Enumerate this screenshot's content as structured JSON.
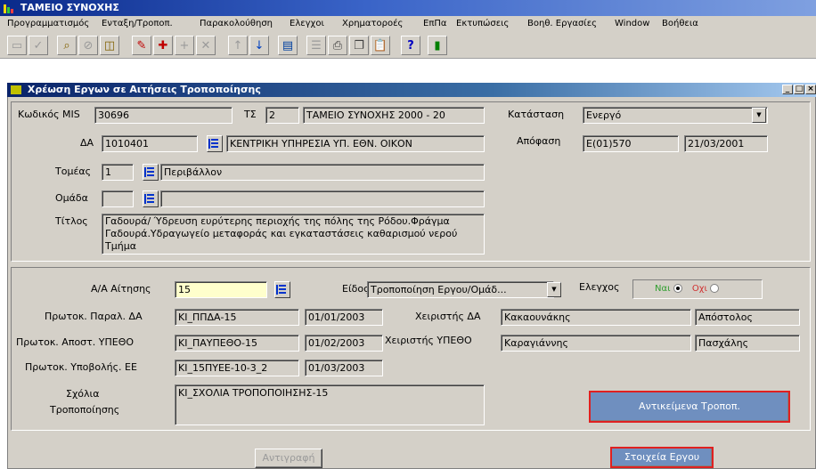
{
  "app": {
    "title": "ΤΑΜΕΙΟ ΣΥΝΟΧΗΣ"
  },
  "menu": {
    "items": [
      {
        "label": "Προγραμματισμός"
      },
      {
        "label": "Ενταξη/Τροποπ."
      },
      {
        "label": "Παρακολούθηση"
      },
      {
        "label": "Ελεγχοι"
      },
      {
        "label": "Χρηματοροές"
      },
      {
        "label": "ΕπΠα"
      },
      {
        "label": "Εκτυπώσεις"
      },
      {
        "label": "Βοηθ. Εργασίες"
      },
      {
        "label": "Window"
      },
      {
        "label": "Βοήθεια"
      }
    ]
  },
  "toolbar": {
    "buttons": [
      {
        "icon": "save-icon"
      },
      {
        "icon": "check-icon"
      },
      {
        "icon": "query-icon"
      },
      {
        "icon": "cancel-query-icon"
      },
      {
        "icon": "execute-query-icon"
      },
      {
        "icon": "edit-icon"
      },
      {
        "icon": "insert-record-icon"
      },
      {
        "icon": "add-icon"
      },
      {
        "icon": "delete-icon"
      },
      {
        "icon": "up-arrow-icon"
      },
      {
        "icon": "down-arrow-icon"
      },
      {
        "icon": "screen-icon"
      },
      {
        "icon": "list-icon"
      },
      {
        "icon": "print-icon"
      },
      {
        "icon": "copy-icon"
      },
      {
        "icon": "paste-icon"
      },
      {
        "icon": "help-icon"
      },
      {
        "icon": "exit-icon"
      }
    ]
  },
  "window": {
    "title": "Χρέωση Εργων σε Αιτήσεις Τροποποίησης"
  },
  "header": {
    "mis_label": "Κωδικός MIS",
    "mis_value": "30696",
    "ts_label": "ΤΣ",
    "ts_value": "2",
    "ts_name": "ΤΑΜΕΙΟ ΣΥΝΟΧΗΣ 2000 - 20",
    "status_label": "Κατάσταση",
    "status_value": "Ενεργό",
    "da_label": "ΔΑ",
    "da_value": "1010401",
    "da_name": "ΚΕΝΤΡΙΚΗ ΥΠΗΡΕΣΙΑ ΥΠ. ΕΘΝ. ΟΙΚΟΝ",
    "decision_label": "Απόφαση",
    "decision_value": "Ε(01)570",
    "decision_date": "21/03/2001",
    "sector_label": "Τομέας",
    "sector_value": "1",
    "sector_name": "Περιβάλλον",
    "group_label": "Ομάδα",
    "group_value": "",
    "group_name": "",
    "title_label": "Τίτλος",
    "title_value": "Γαδουρά/ Ύδρευση ευρύτερης περιοχής της πόλης της Ρόδου.Φράγμα Γαδουρά.Υδραγωγείο μεταφοράς και εγκαταστάσεις καθαρισμού νερού Τμήμα"
  },
  "request": {
    "aa_label": "Α/Α Αίτησης",
    "aa_value": "15",
    "type_label": "Είδος",
    "type_value": "Τροποποίηση Εργου/Ομάδ...",
    "check_label": "Ελεγχος",
    "yes_label": "Ναι",
    "no_label": "Οχι",
    "prot_para_label": "Πρωτοκ. Παραλ. ΔΑ",
    "prot_para_value": "ΚΙ_ΠΠΔΑ-15",
    "prot_para_date": "01/01/2003",
    "handler_da_label": "Χειριστής ΔΑ",
    "handler_da_last": "Κακαουνάκης",
    "handler_da_first": "Απόστολος",
    "prot_apost_label": "Πρωτοκ. Αποστ. ΥΠΕΘΟ",
    "prot_apost_value": "ΚΙ_ΠΑΥΠΕΘΟ-15",
    "prot_apost_date": "01/02/2003",
    "handler_ypetho_label": "Χειριστής ΥΠΕΘΟ",
    "handler_ypetho_last": "Καραγιάννης",
    "handler_ypetho_first": "Πασχάλης",
    "prot_ypov_label": "Πρωτοκ. Υποβολής. ΕΕ",
    "prot_ypov_value": "ΚΙ_15ΠΥΕΕ-10-3_2",
    "prot_ypov_date": "01/03/2003",
    "comments_label_1": "Σχόλια",
    "comments_label_2": "Τροποποίησης",
    "comments_value": "ΚΙ_ΣΧΟΛΙΑ ΤΡΟΠΟΠΟΙΗΣΗΣ-15",
    "objects_button": "Αντικείμενα Τροποπ."
  },
  "footer": {
    "copy_button": "Αντιγραφή",
    "project_button": "Στοιχεία Εργου"
  },
  "colors": {
    "accent_red": "#e02020",
    "highlight_blue": "#6f8fbf",
    "radio_yes": "#2e9e2e",
    "radio_no": "#d03030"
  }
}
